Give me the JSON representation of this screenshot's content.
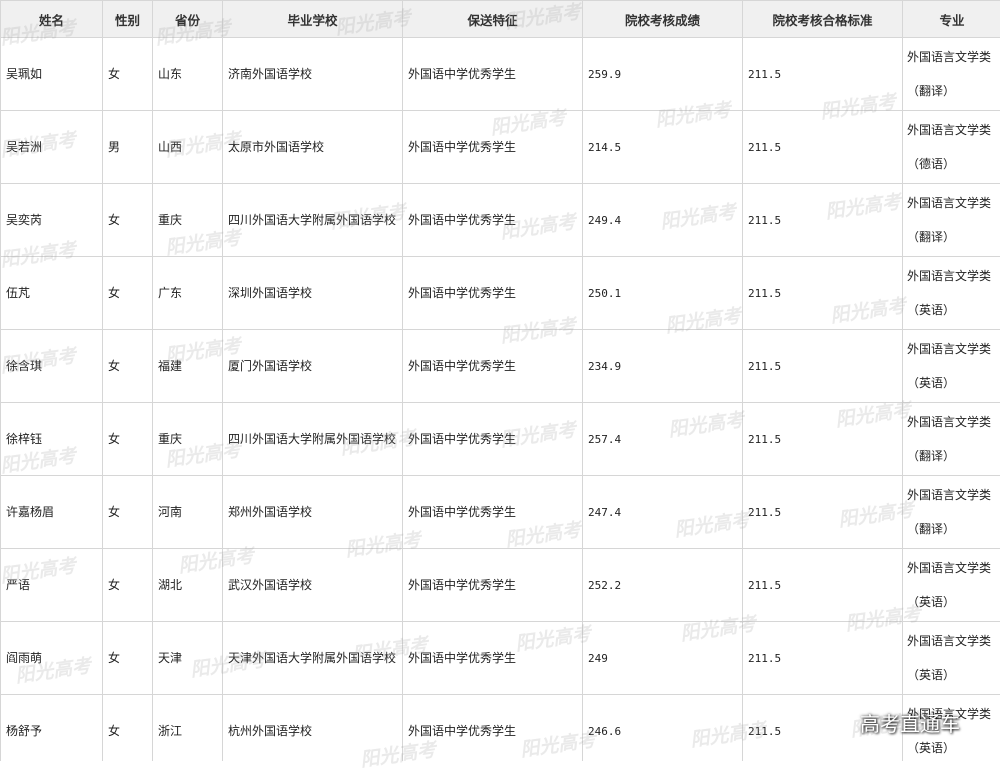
{
  "headers": [
    "姓名",
    "性别",
    "省份",
    "毕业学校",
    "保送特征",
    "院校考核成绩",
    "院校考核合格标准",
    "专业"
  ],
  "rows": [
    {
      "name": "吴珮如",
      "gender": "女",
      "province": "山东",
      "school": "济南外国语学校",
      "feature": "外国语中学优秀学生",
      "score": "259.9",
      "standard": "211.5",
      "major_line1": "外国语言文学类",
      "major_line2": "（翻译）"
    },
    {
      "name": "吴若洲",
      "gender": "男",
      "province": "山西",
      "school": "太原市外国语学校",
      "feature": "外国语中学优秀学生",
      "score": "214.5",
      "standard": "211.5",
      "major_line1": "外国语言文学类",
      "major_line2": "（德语）"
    },
    {
      "name": "吴奕芮",
      "gender": "女",
      "province": "重庆",
      "school": "四川外国语大学附属外国语学校",
      "feature": "外国语中学优秀学生",
      "score": "249.4",
      "standard": "211.5",
      "major_line1": "外国语言文学类",
      "major_line2": "（翻译）"
    },
    {
      "name": "伍芃",
      "gender": "女",
      "province": "广东",
      "school": "深圳外国语学校",
      "feature": "外国语中学优秀学生",
      "score": "250.1",
      "standard": "211.5",
      "major_line1": "外国语言文学类",
      "major_line2": "（英语）"
    },
    {
      "name": "徐含琪",
      "gender": "女",
      "province": "福建",
      "school": "厦门外国语学校",
      "feature": "外国语中学优秀学生",
      "score": "234.9",
      "standard": "211.5",
      "major_line1": "外国语言文学类",
      "major_line2": "（英语）"
    },
    {
      "name": "徐梓钰",
      "gender": "女",
      "province": "重庆",
      "school": "四川外国语大学附属外国语学校",
      "feature": "外国语中学优秀学生",
      "score": "257.4",
      "standard": "211.5",
      "major_line1": "外国语言文学类",
      "major_line2": "（翻译）"
    },
    {
      "name": "许嘉杨眉",
      "gender": "女",
      "province": "河南",
      "school": "郑州外国语学校",
      "feature": "外国语中学优秀学生",
      "score": "247.4",
      "standard": "211.5",
      "major_line1": "外国语言文学类",
      "major_line2": "（翻译）"
    },
    {
      "name": "严语",
      "gender": "女",
      "province": "湖北",
      "school": "武汉外国语学校",
      "feature": "外国语中学优秀学生",
      "score": "252.2",
      "standard": "211.5",
      "major_line1": "外国语言文学类",
      "major_line2": "（英语）"
    },
    {
      "name": "阎雨萌",
      "gender": "女",
      "province": "天津",
      "school": "天津外国语大学附属外国语学校",
      "feature": "外国语中学优秀学生",
      "score": "249",
      "standard": "211.5",
      "major_line1": "外国语言文学类",
      "major_line2": "（英语）"
    },
    {
      "name": "杨舒予",
      "gender": "女",
      "province": "浙江",
      "school": "杭州外国语学校",
      "feature": "外国语中学优秀学生",
      "score": "246.6",
      "standard": "211.5",
      "major_line1": "外国语言文学类",
      "major_line2": "（英语）"
    }
  ],
  "watermark_text": "阳光高考",
  "logo_text": "高考直通车"
}
